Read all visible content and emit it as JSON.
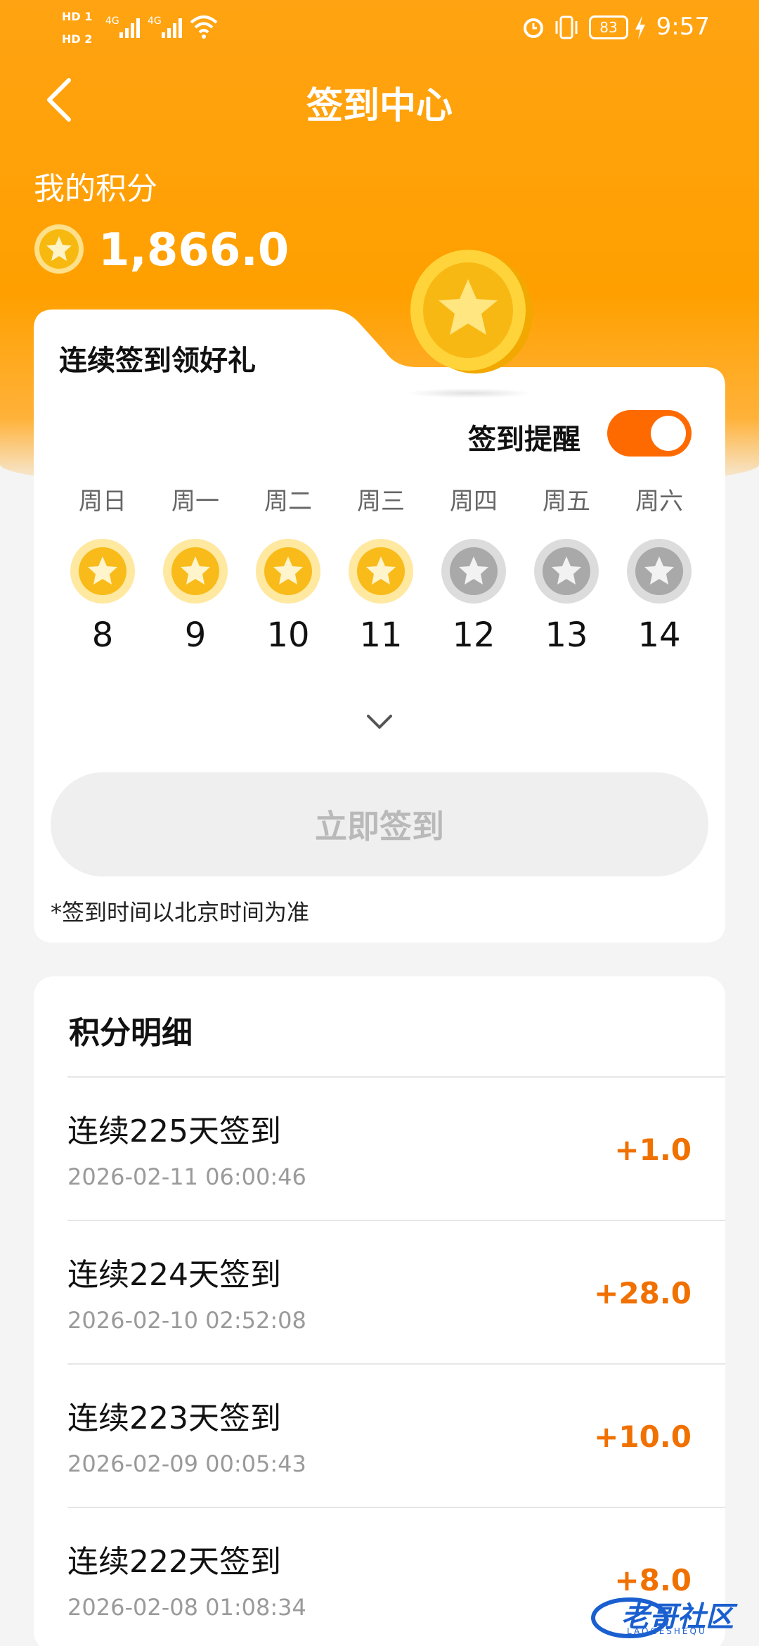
{
  "status_bar": {
    "hd1": "HD 1",
    "hd2": "HD 2",
    "signal1": "4G",
    "signal2": "4G",
    "battery": "83",
    "time": "9:57"
  },
  "nav": {
    "title": "签到中心"
  },
  "points": {
    "label": "我的积分",
    "value": "1,866.0"
  },
  "signin_card": {
    "title": "连续签到领好礼",
    "reminder_label": "签到提醒",
    "reminder_on": true,
    "days": [
      {
        "name": "周日",
        "date": "8",
        "checked": true
      },
      {
        "name": "周一",
        "date": "9",
        "checked": true
      },
      {
        "name": "周二",
        "date": "10",
        "checked": true
      },
      {
        "name": "周三",
        "date": "11",
        "checked": true
      },
      {
        "name": "周四",
        "date": "12",
        "checked": false
      },
      {
        "name": "周五",
        "date": "13",
        "checked": false
      },
      {
        "name": "周六",
        "date": "14",
        "checked": false
      }
    ],
    "button_label": "立即签到",
    "note": "*签到时间以北京时间为准"
  },
  "details": {
    "title": "积分明细",
    "records": [
      {
        "title": "连续225天签到",
        "time": "2026-02-11 06:00:46",
        "amount": "+1.0"
      },
      {
        "title": "连续224天签到",
        "time": "2026-02-10 02:52:08",
        "amount": "+28.0"
      },
      {
        "title": "连续223天签到",
        "time": "2026-02-09 00:05:43",
        "amount": "+10.0"
      },
      {
        "title": "连续222天签到",
        "time": "2026-02-08 01:08:34",
        "amount": "+8.0"
      }
    ]
  },
  "watermark": {
    "text": "老哥社区",
    "sub": "LAOGESHEQU"
  },
  "colors": {
    "header": "#ffa000",
    "accent": "#ff6a00",
    "amount": "#f07000",
    "coin_gold": "#ffc21a",
    "coin_silver": "#b8b8b8"
  }
}
